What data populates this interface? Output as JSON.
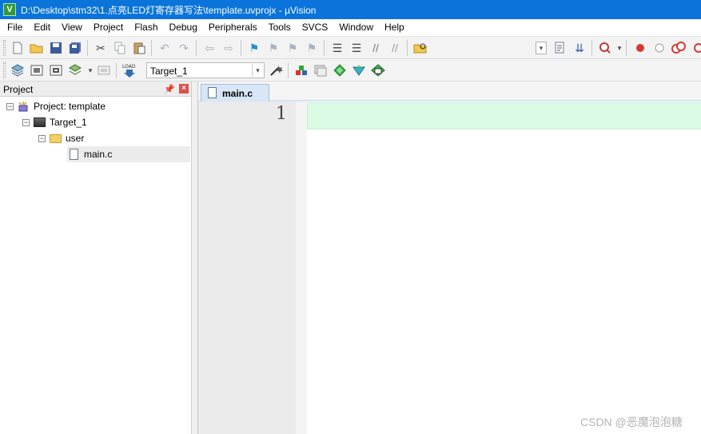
{
  "window": {
    "title": "D:\\Desktop\\stm32\\1.点亮LED灯寄存器写法\\template.uvprojx - µVision",
    "app_icon": "V"
  },
  "menu": [
    "File",
    "Edit",
    "View",
    "Project",
    "Flash",
    "Debug",
    "Peripherals",
    "Tools",
    "SVCS",
    "Window",
    "Help"
  ],
  "toolbar": {
    "target_select": "Target_1"
  },
  "project_panel": {
    "title": "Project",
    "tree": {
      "project": "Project: template",
      "target": "Target_1",
      "group": "user",
      "file": "main.c"
    }
  },
  "editor": {
    "active_tab": "main.c",
    "line_numbers": [
      "1"
    ],
    "current_line_color": "#dcfbe5"
  },
  "watermark": "CSDN @恶魔泡泡糖",
  "colors": {
    "titlebar": "#0a74da",
    "tab_active": "#d9e6f7"
  }
}
